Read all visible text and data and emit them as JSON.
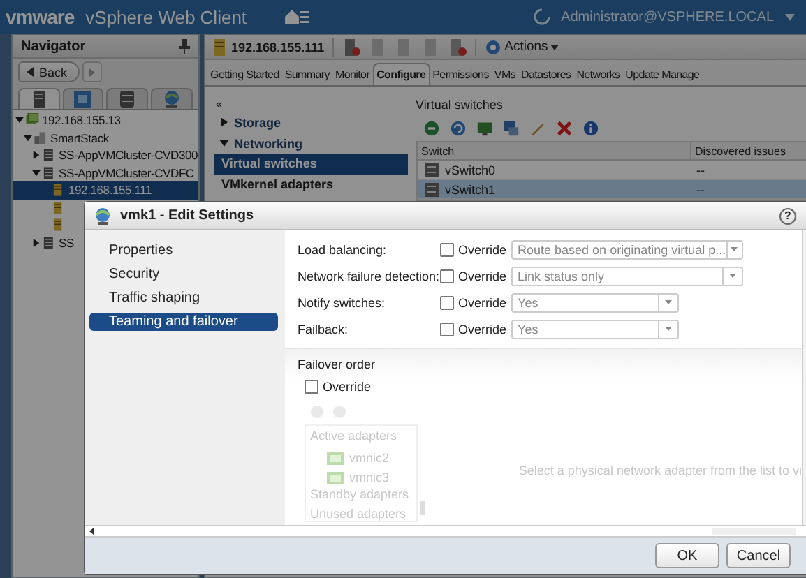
{
  "header": {
    "logo": "vmware",
    "product": "vSphere Web Client",
    "user": "Administrator@VSPHERE.LOCAL"
  },
  "navigator": {
    "title": "Navigator",
    "back": "Back",
    "tabs": [
      {
        "kind": "hosts",
        "selected": true
      },
      {
        "kind": "vms",
        "selected": false
      },
      {
        "kind": "storage",
        "selected": false
      },
      {
        "kind": "network",
        "selected": false
      }
    ],
    "tree": [
      {
        "label": "192.168.155.13",
        "kind": "vcenter",
        "expanded": true,
        "selected": false,
        "children": [
          {
            "label": "SmartStack",
            "kind": "datacenter",
            "expanded": true,
            "selected": false,
            "children": [
              {
                "label": "SS-AppVMCluster-CVD300",
                "kind": "cluster",
                "expanded": false,
                "selected": false
              },
              {
                "label": "SS-AppVMCluster-CVDFC",
                "kind": "cluster",
                "expanded": true,
                "selected": false,
                "children": [
                  {
                    "label": "192.168.155.111",
                    "kind": "host",
                    "selected": true
                  },
                  {
                    "kind": "host",
                    "selected": false
                  },
                  {
                    "kind": "host",
                    "selected": false
                  }
                ]
              },
              {
                "label": "SS",
                "kind": "cluster",
                "expanded": false,
                "selected": false
              }
            ]
          }
        ]
      }
    ]
  },
  "object": {
    "name": "192.168.155.111",
    "actions": "Actions"
  },
  "tabs": [
    {
      "label": "Getting Started",
      "selected": false
    },
    {
      "label": "Summary",
      "selected": false
    },
    {
      "label": "Monitor",
      "selected": false
    },
    {
      "label": "Configure",
      "selected": true
    },
    {
      "label": "Permissions",
      "selected": false
    },
    {
      "label": "VMs",
      "selected": false
    },
    {
      "label": "Datastores",
      "selected": false
    },
    {
      "label": "Networks",
      "selected": false
    },
    {
      "label": "Update Manage",
      "selected": false
    }
  ],
  "subnav": {
    "collapse": "«",
    "items": [
      {
        "label": "Storage",
        "kind": "group",
        "expanded": false
      },
      {
        "label": "Networking",
        "kind": "group",
        "expanded": true
      },
      {
        "label": "Virtual switches",
        "kind": "item",
        "selected": true
      },
      {
        "label": "VMkernel adapters",
        "kind": "item",
        "selected": false
      }
    ]
  },
  "panel": {
    "title": "Virtual switches",
    "columns": [
      "Switch",
      "Discovered issues"
    ],
    "rows": [
      {
        "cells": [
          "vSwitch0",
          "--"
        ],
        "selected": false
      },
      {
        "cells": [
          "vSwitch1",
          "--"
        ],
        "selected": true
      }
    ]
  },
  "dialog": {
    "title": "vmk1 - Edit Settings",
    "help": "?",
    "sections": [
      {
        "label": "Properties",
        "selected": false
      },
      {
        "label": "Security",
        "selected": false
      },
      {
        "label": "Traffic shaping",
        "selected": false
      },
      {
        "label": "Teaming and failover",
        "selected": true
      }
    ],
    "settings": [
      {
        "label": "Load balancing:",
        "override_label": "Override",
        "override": false,
        "value": "Route based on originating virtual p..."
      },
      {
        "label": "Network failure detection:",
        "override_label": "Override",
        "override": false,
        "value": "Link status only"
      },
      {
        "label": "Notify switches:",
        "override_label": "Override",
        "override": false,
        "value": "Yes"
      },
      {
        "label": "Failback:",
        "override_label": "Override",
        "override": false,
        "value": "Yes"
      }
    ],
    "failover": {
      "title": "Failover order",
      "override_label": "Override",
      "override": false,
      "disabled": true,
      "groups": [
        {
          "label": "Active adapters",
          "adapters": [
            "vmnic2",
            "vmnic3"
          ]
        },
        {
          "label": "Standby adapters"
        },
        {
          "label": "Unused adapters"
        }
      ],
      "hint": "Select a physical network adapter from the list to vi"
    },
    "buttons": [
      "OK",
      "Cancel"
    ]
  }
}
